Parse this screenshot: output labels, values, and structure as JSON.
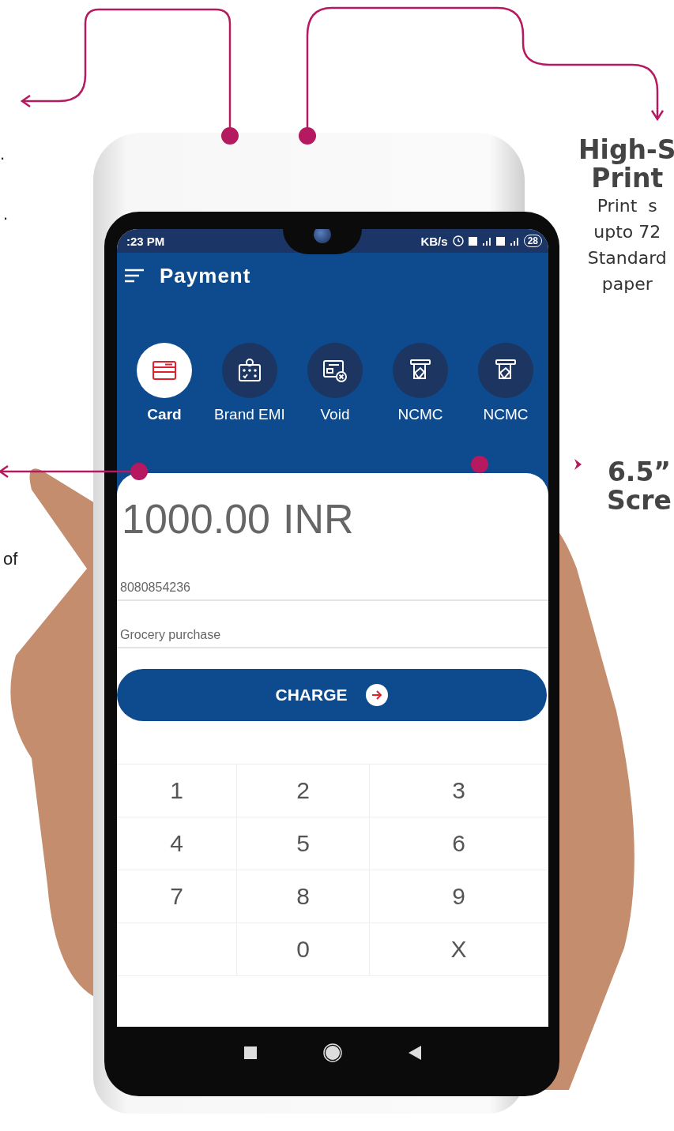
{
  "left_notes": [
    ".",
    ".",
    "of"
  ],
  "right_notes": [
    {
      "kind": "feature",
      "title_lines": [
        "High-S",
        "Print"
      ],
      "body_lines": [
        "Print  s",
        "upto 72",
        "Standard",
        "paper"
      ]
    },
    {
      "kind": "bullet",
      "title_lines": [
        "6.5”",
        "Scre"
      ]
    }
  ],
  "status_bar": {
    "time": ":23 PM",
    "speed": "KB/s",
    "battery": "28"
  },
  "app_bar": {
    "title": "Payment"
  },
  "payment_modes": [
    {
      "kind": "card",
      "label": "Card",
      "selected": true
    },
    {
      "kind": "emi",
      "label": "Brand EMI",
      "selected": false
    },
    {
      "kind": "void",
      "label": "Void",
      "selected": false
    },
    {
      "kind": "ncmc",
      "label": "NCMC",
      "selected": false
    },
    {
      "kind": "ncmc",
      "label": "NCMC",
      "selected": false
    }
  ],
  "amount": {
    "value": "1000.00",
    "currency": "INR"
  },
  "fields": [
    {
      "value": "8080854236"
    },
    {
      "value": "Grocery purchase"
    }
  ],
  "charge_button": {
    "label": "CHARGE"
  },
  "keypad": [
    {
      "kind": "digit",
      "label": "1"
    },
    {
      "kind": "digit",
      "label": "2"
    },
    {
      "kind": "digit",
      "label": "3"
    },
    {
      "kind": "digit",
      "label": "4"
    },
    {
      "kind": "digit",
      "label": "5"
    },
    {
      "kind": "digit",
      "label": "6"
    },
    {
      "kind": "digit",
      "label": "7"
    },
    {
      "kind": "digit",
      "label": "8"
    },
    {
      "kind": "digit",
      "label": "9"
    },
    {
      "kind": "blank"
    },
    {
      "kind": "digit",
      "label": "0"
    },
    {
      "kind": "digit",
      "label": "X"
    }
  ]
}
